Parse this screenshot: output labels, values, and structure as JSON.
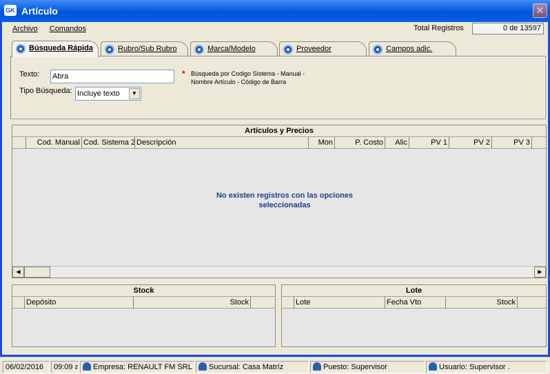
{
  "window": {
    "title": "Artículo",
    "icon_text": "GK",
    "close_glyph": "✕"
  },
  "menu": {
    "archivo": "Archivo",
    "comandos": "Comandos"
  },
  "total": {
    "label": "Total Registros",
    "value": "0 de 13597"
  },
  "tabs": [
    {
      "label": "Búsqueda Rápida",
      "active": true
    },
    {
      "label": "Rubro/Sub Rubro"
    },
    {
      "label": "Marca/Modelo"
    },
    {
      "label": "Proveedor"
    },
    {
      "label": "Campos adic."
    }
  ],
  "search": {
    "texto_label": "Texto:",
    "texto_value": "Abra",
    "tipo_label": "Tipo Búsqueda:",
    "tipo_value": "Incluye texto",
    "asterisk": "*",
    "hint_line1": "Búsqueda por Codigo Sistema - Manual -",
    "hint_line2": "Nombre Artículo - Código de Barra"
  },
  "main_grid": {
    "caption": "Artículos y Precios",
    "columns": [
      "Cod. Manual",
      "Cod. Sistema 2",
      "Descripción",
      "Mon",
      "P. Costo",
      "Alic",
      "PV 1",
      "PV 2",
      "PV 3"
    ],
    "empty_line1": "No existen registros con las opciones",
    "empty_line2": "seleccionadas"
  },
  "stock_grid": {
    "caption": "Stock",
    "columns": [
      "Depósito",
      "Stock"
    ]
  },
  "lote_grid": {
    "caption": "Lote",
    "columns": [
      "Lote",
      "Fecha Vto",
      "Stock"
    ]
  },
  "statusbar": {
    "date": "06/02/2016",
    "time": "09:09 a",
    "empresa": "Empresa: RENAULT FM SRL",
    "sucursal": "Sucursal: Casa Matríz",
    "puesto": "Puesto: Supervisor",
    "usuario": "Usuario: Supervisor ."
  },
  "colors": {
    "titlebar": "#0a5fe0",
    "accent_text": "#1f3d8c",
    "asterisk": "#d00000"
  }
}
